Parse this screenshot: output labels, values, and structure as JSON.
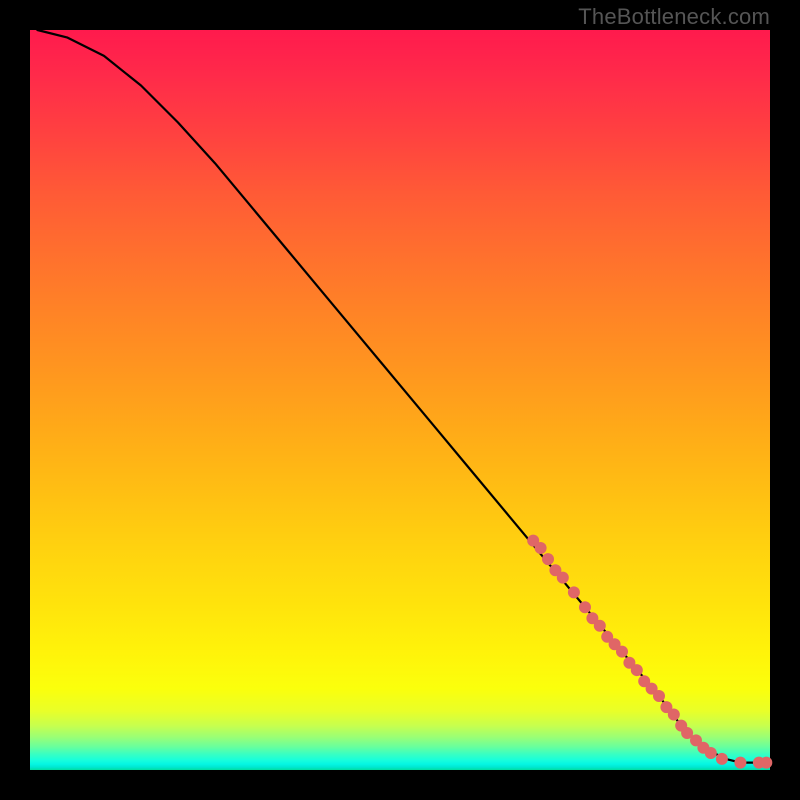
{
  "watermark": "TheBottleneck.com",
  "chart_data": {
    "type": "line",
    "title": "",
    "xlabel": "",
    "ylabel": "",
    "xlim": [
      0,
      100
    ],
    "ylim": [
      0,
      100
    ],
    "grid": false,
    "legend": false,
    "series": [
      {
        "name": "curve",
        "type": "line",
        "color": "#000000",
        "x": [
          1,
          5,
          10,
          15,
          20,
          25,
          30,
          35,
          40,
          45,
          50,
          55,
          60,
          65,
          70,
          75,
          80,
          85,
          88,
          90,
          92,
          94,
          96,
          98,
          100
        ],
        "y": [
          100,
          99.0,
          96.5,
          92.5,
          87.5,
          82.0,
          76.0,
          70.0,
          64.0,
          58.0,
          52.0,
          46.0,
          40.0,
          34.0,
          28.0,
          22.0,
          16.0,
          10.0,
          6.0,
          4.0,
          2.5,
          1.5,
          1.0,
          1.0,
          1.0
        ]
      },
      {
        "name": "markers",
        "type": "scatter",
        "color": "#e06666",
        "radius_px": 6,
        "x": [
          68,
          69,
          70,
          71,
          72,
          73.5,
          75,
          76,
          77,
          78,
          79,
          80,
          81,
          82,
          83,
          84,
          85,
          86,
          87,
          88,
          88.8,
          90,
          91,
          92,
          93.5,
          96,
          98.5,
          99.5
        ],
        "y": [
          31.0,
          30.0,
          28.5,
          27.0,
          26.0,
          24.0,
          22.0,
          20.5,
          19.5,
          18.0,
          17.0,
          16.0,
          14.5,
          13.5,
          12.0,
          11.0,
          10.0,
          8.5,
          7.5,
          6.0,
          5.0,
          4.0,
          3.0,
          2.3,
          1.5,
          1.0,
          1.0,
          1.0
        ]
      }
    ]
  }
}
